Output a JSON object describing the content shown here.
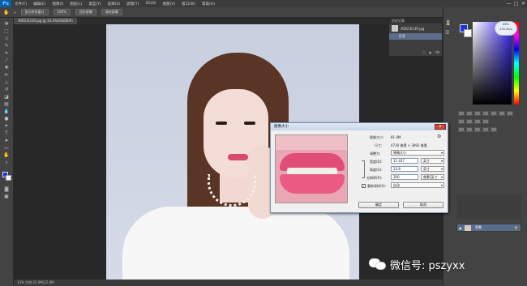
{
  "app": {
    "logo": "Ps"
  },
  "menubar": {
    "items": [
      "文件(F)",
      "编辑(E)",
      "图像(I)",
      "图层(L)",
      "类型(Y)",
      "选择(S)",
      "滤镜(T)",
      "3D(D)",
      "视图(V)",
      "窗口(W)",
      "帮助(H)"
    ],
    "window_controls": [
      "—",
      "□",
      "✕"
    ]
  },
  "optionsbar": {
    "buttons": [
      "显示所有窗口",
      "100%",
      "适合屏幕",
      "填充屏幕"
    ]
  },
  "document": {
    "tab": "#DSC6339.jpg @ 33.3%(RGB/8#)"
  },
  "statusbar": {
    "text": "33%   文档:22.9M/22.9M"
  },
  "history_panel": {
    "title": "历史记录",
    "snapshot": "#DSC6339.jpg",
    "entry": "打开"
  },
  "color_badge": {
    "line1": "43%",
    "line2": "150.0K/s"
  },
  "dialog": {
    "title": "图像大小",
    "image_size_label": "图像大小:",
    "image_size_value": "81.0M",
    "dimensions_label": "尺寸:",
    "dimensions_value": "4730 像素 × 3992 像素",
    "fit_label": "调整为:",
    "fit_value": "原稿大小",
    "width_label": "宽度(D):",
    "width_value": "11.437",
    "width_unit": "英寸",
    "height_label": "高度(G):",
    "height_value": "13.8",
    "height_unit": "英寸",
    "resolution_label": "分辨率(R):",
    "resolution_value": "300",
    "resolution_unit": "像素/英寸",
    "resample_label": "重新采样(S):",
    "resample_value": "自动",
    "resample_checked": "✓",
    "ok_label": "确定",
    "cancel_label": "取消",
    "close_label": "x"
  },
  "layers_panel": {
    "layer_name": "背景"
  },
  "watermark": {
    "text": "微信号: pszyxx"
  },
  "colors": {
    "foreground": "#1f35e0",
    "background": "#ffffff",
    "accent": "#0a5fa8"
  }
}
